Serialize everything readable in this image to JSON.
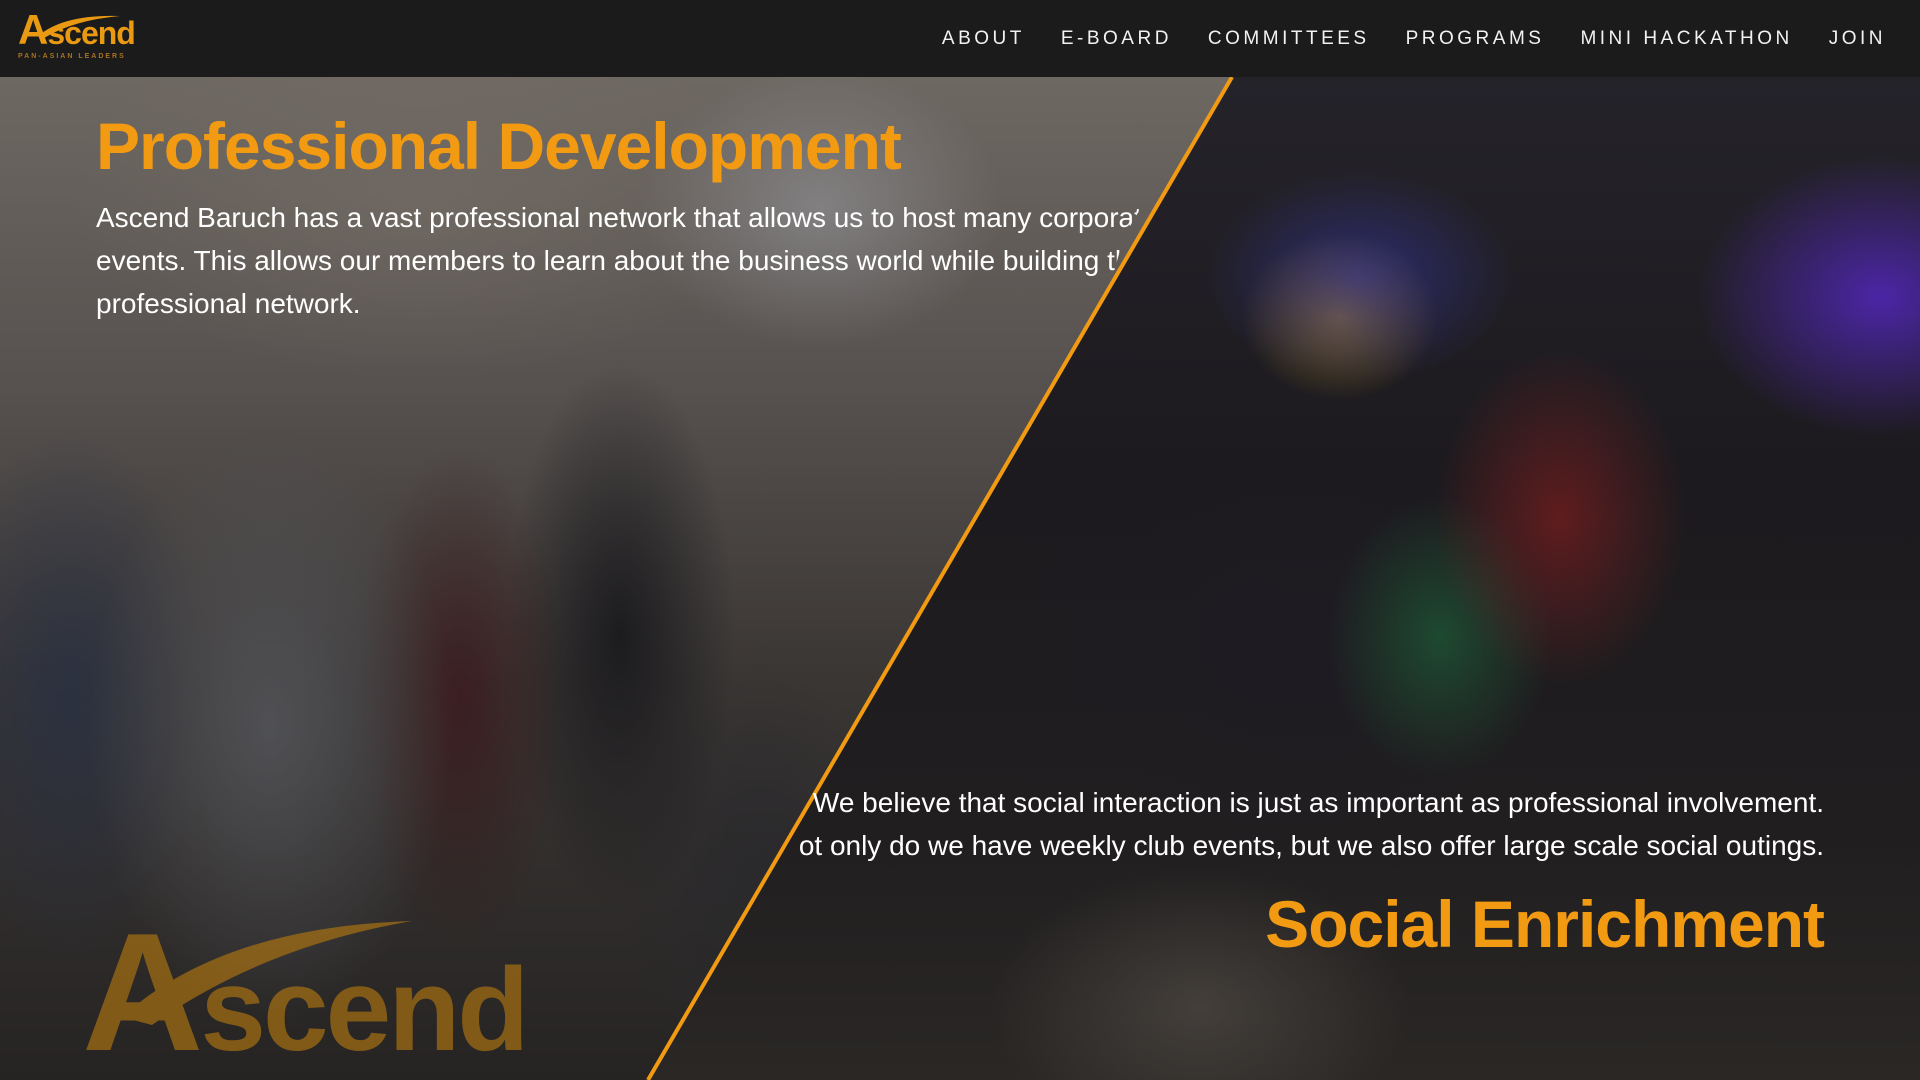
{
  "brand": {
    "name": "Ascend",
    "tagline": "PAN-ASIAN LEADERS",
    "accent_color": "#f29b12"
  },
  "nav": {
    "items": [
      {
        "label": "ABOUT"
      },
      {
        "label": "E-BOARD"
      },
      {
        "label": "COMMITTEES"
      },
      {
        "label": "PROGRAMS"
      },
      {
        "label": "MINI HACKATHON"
      },
      {
        "label": "JOIN"
      }
    ]
  },
  "left_panel": {
    "title": "Professional Development",
    "description": "Ascend Baruch has a vast professional network that allows us to host many corporate events. This allows our members to learn about the business world while building their professional network.",
    "image": "group-photo-professional-event"
  },
  "right_panel": {
    "title": "Social Enrichment",
    "description": "We believe that social interaction is just as important as professional involvement. Not only do we have weekly club events, but we also offer large scale social outings.",
    "image": "group-photo-holiday-party"
  },
  "watermark": {
    "word": "Ascend"
  }
}
